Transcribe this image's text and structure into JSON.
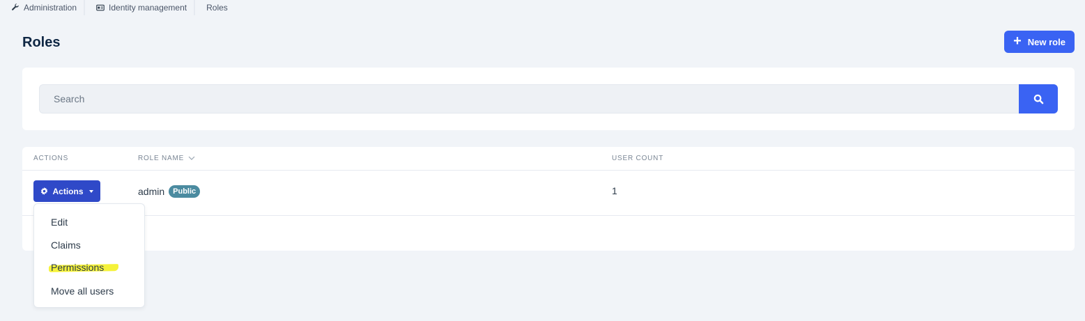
{
  "breadcrumb": {
    "items": [
      {
        "label": "Administration",
        "icon": "wrench-icon"
      },
      {
        "label": "Identity management",
        "icon": "id-card-icon"
      },
      {
        "label": "Roles",
        "icon": ""
      }
    ]
  },
  "page": {
    "title": "Roles"
  },
  "toolbar": {
    "new_role_label": "New role"
  },
  "search": {
    "placeholder": "Search",
    "value": ""
  },
  "table": {
    "headers": {
      "actions": "ACTIONS",
      "role_name": "ROLE NAME",
      "user_count": "USER COUNT"
    },
    "rows": [
      {
        "actions_label": "Actions",
        "role_name": "admin",
        "badge": "Public",
        "user_count": "1"
      }
    ]
  },
  "actions_menu": {
    "items": [
      "Edit",
      "Claims",
      "Permissions",
      "Move all users"
    ],
    "highlighted": "Permissions"
  },
  "colors": {
    "primary": "#3a63f3",
    "actions_button": "#2f49c8",
    "badge": "#4b8ba0",
    "highlight": "#f5f23a",
    "background": "#f1f4f8"
  }
}
